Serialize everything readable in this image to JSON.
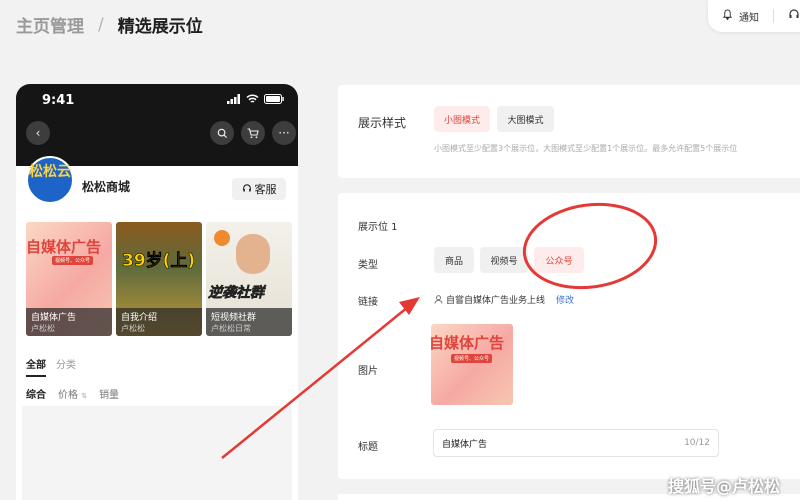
{
  "breadcrumb": {
    "parent": "主页管理",
    "separator": "/",
    "current": "精选展示位"
  },
  "header": {
    "notify_label": "通知"
  },
  "phone": {
    "time": "9:41",
    "shop_name": "松松商城",
    "avatar_text": "松松云",
    "service_label": "客服",
    "cards": [
      {
        "title": "自媒体广告",
        "author": "卢松松",
        "img_headline": "自媒体广告",
        "img_tags": "视频号、公众号"
      },
      {
        "title": "自我介绍",
        "author": "卢松松",
        "img_headline": "39岁(上)"
      },
      {
        "title": "短视频社群",
        "author": "卢松松日常",
        "img_headline": "逆袭社群"
      }
    ],
    "tabs": [
      "全部",
      "分类"
    ],
    "sorts": [
      "综合",
      "价格",
      "销量"
    ]
  },
  "style_panel": {
    "label": "展示样式",
    "options": [
      "小图模式",
      "大图模式"
    ],
    "selected": "小图模式",
    "hint": "小图模式至少配置3个展示位，大图模式至少配置1个展示位。最多允许配置5个展示位"
  },
  "slot_panel": {
    "title": "展示位 1",
    "type_label": "类型",
    "types": [
      "商品",
      "视频号",
      "公众号"
    ],
    "selected_type": "公众号",
    "link_label": "链接",
    "link_value": "自嘗自媒体广告业务上线",
    "edit_label": "修改",
    "image_label": "图片",
    "image_headline": "自媒体广告",
    "image_tags": "视频号、公众号",
    "title_label": "标题",
    "title_value": "自媒体广告",
    "title_count": "10/12"
  },
  "watermark": "搜狐号@卢松松",
  "colors": {
    "accent": "#e3463a",
    "link": "#3b6fd8",
    "annotation": "#e53935"
  }
}
